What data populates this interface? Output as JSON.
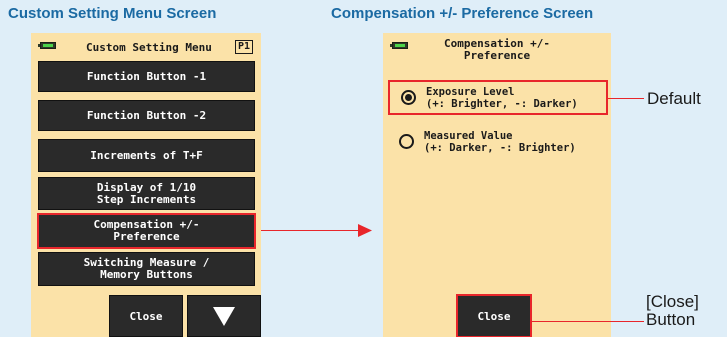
{
  "titles": {
    "left": "Custom Setting Menu Screen",
    "right": "Compensation +/- Preference Screen"
  },
  "menu": {
    "header": "Custom Setting Menu",
    "page": "P1",
    "items": [
      {
        "lines": [
          "Function Button -1"
        ]
      },
      {
        "lines": [
          "Function Button -2"
        ]
      },
      {
        "lines": [
          "Increments of T+F"
        ]
      },
      {
        "lines": [
          "Display of 1/10",
          "Step Increments"
        ]
      },
      {
        "lines": [
          "Compensation +/-",
          "Preference"
        ],
        "selected": true
      },
      {
        "lines": [
          "Switching Measure /",
          "Memory Buttons"
        ]
      }
    ],
    "close_label": "Close",
    "next_icon": "down-triangle-icon"
  },
  "preference": {
    "title_lines": [
      "Compensation +/-",
      "Preference"
    ],
    "options": [
      {
        "lines": [
          "Exposure Level",
          "(+: Brighter, -: Darker)"
        ],
        "selected": true
      },
      {
        "lines": [
          "Measured Value",
          "(+: Darker, -: Brighter)"
        ],
        "selected": false
      }
    ],
    "close_label": "Close"
  },
  "callouts": {
    "default": "Default",
    "close_button": [
      "[Close]",
      "Button"
    ]
  },
  "colors": {
    "title": "#1b6aa3",
    "highlight": "#e8262b",
    "screen": "#fbe2a8",
    "button": "#2a2a2a",
    "background": "#dfeef8"
  }
}
